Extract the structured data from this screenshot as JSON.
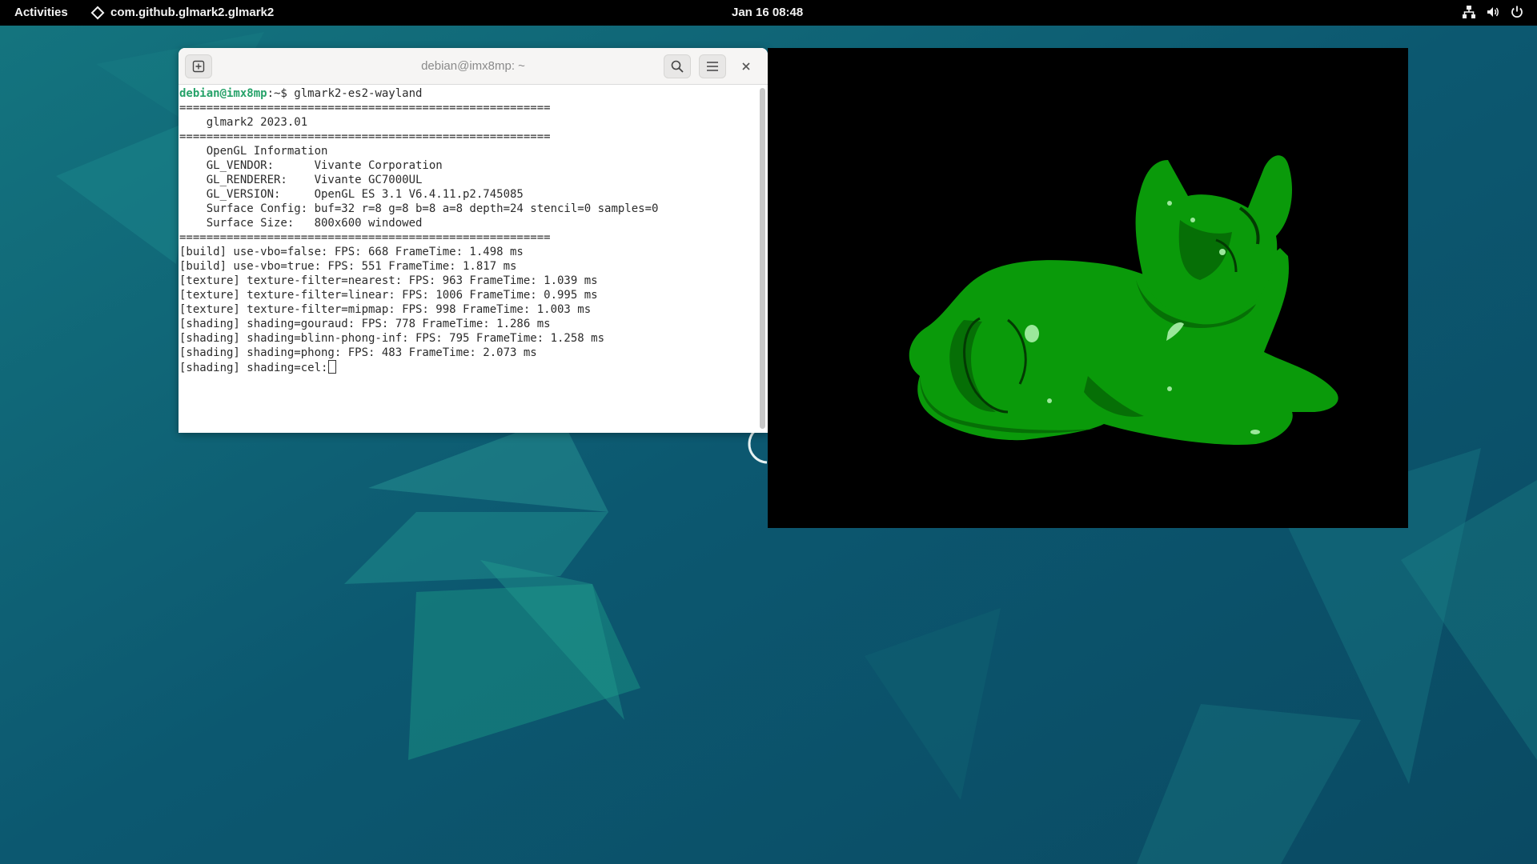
{
  "topbar": {
    "activities": "Activities",
    "app_name": "com.github.glmark2.glmark2",
    "clock": "Jan 16  08:48"
  },
  "terminal": {
    "title": "debian@imx8mp: ~",
    "prompt_user": "debian@imx8mp",
    "prompt_suffix": ":~$ ",
    "command": "glmark2-es2-wayland",
    "lines": [
      "=======================================================",
      "    glmark2 2023.01",
      "=======================================================",
      "    OpenGL Information",
      "    GL_VENDOR:      Vivante Corporation",
      "    GL_RENDERER:    Vivante GC7000UL",
      "    GL_VERSION:     OpenGL ES 3.1 V6.4.11.p2.745085",
      "    Surface Config: buf=32 r=8 g=8 b=8 a=8 depth=24 stencil=0 samples=0",
      "    Surface Size:   800x600 windowed",
      "=======================================================",
      "[build] use-vbo=false: FPS: 668 FrameTime: 1.498 ms",
      "[build] use-vbo=true: FPS: 551 FrameTime: 1.817 ms",
      "[texture] texture-filter=nearest: FPS: 963 FrameTime: 1.039 ms",
      "[texture] texture-filter=linear: FPS: 1006 FrameTime: 0.995 ms",
      "[texture] texture-filter=mipmap: FPS: 998 FrameTime: 1.003 ms",
      "[shading] shading=gouraud: FPS: 778 FrameTime: 1.286 ms",
      "[shading] shading=blinn-phong-inf: FPS: 795 FrameTime: 1.258 ms",
      "[shading] shading=phong: FPS: 483 FrameTime: 2.073 ms"
    ],
    "current_line": "[shading] shading=cel:"
  },
  "colors": {
    "prompt": "#26a269",
    "cat_main": "#0a9a0a",
    "cat_shadow": "#066f06",
    "cat_highlight": "#9be89b",
    "topbar": "#000000"
  },
  "icons": {
    "new_tab": "new-tab-icon",
    "search": "search-icon",
    "menu": "hamburger-menu-icon",
    "close": "close-icon",
    "network": "network-icon",
    "volume": "volume-icon",
    "power": "power-icon"
  }
}
